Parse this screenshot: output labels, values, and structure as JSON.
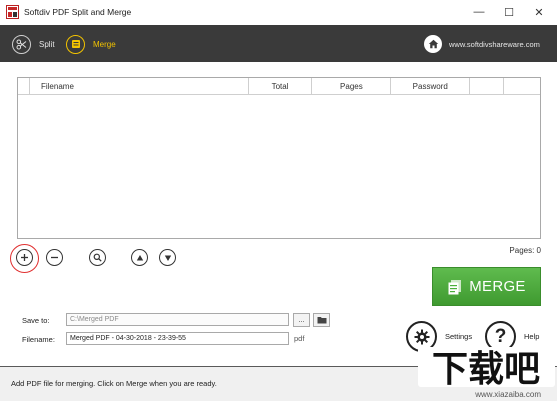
{
  "window": {
    "title": "Softdiv PDF Split and Merge",
    "controls": {
      "minimize": "—",
      "maximize": "☐",
      "close": "✕"
    }
  },
  "topbar": {
    "modes": [
      {
        "label": "Split",
        "icon": "scissors-icon",
        "active": false
      },
      {
        "label": "Merge",
        "icon": "merge-doc-icon",
        "active": true
      }
    ],
    "site_label": "www.softdivshareware.com",
    "site_icon": "home-icon",
    "colors": {
      "background": "#3a3a3a",
      "active": "#f2c300"
    }
  },
  "file_table": {
    "columns": [
      "",
      "Filename",
      "Total",
      "Pages",
      "Password",
      "",
      ""
    ],
    "rows": []
  },
  "list_controls": {
    "add_icon": "plus-icon",
    "remove_icon": "minus-icon",
    "preview_icon": "search-icon",
    "move_up_icon": "arrow-up-icon",
    "move_down_icon": "arrow-down-icon",
    "pages_count": "Pages: 0"
  },
  "merge_button": {
    "label": "MERGE",
    "color": "#4caf3c"
  },
  "output": {
    "save_to_label": "Save to:",
    "save_to_value": "C:\\Merged PDF",
    "browse_label": "...",
    "filename_label": "Filename:",
    "filename_value": "Merged PDF - 04-30-2018 - 23-39-55",
    "extension": "pdf"
  },
  "settings": {
    "label": "Settings",
    "icon": "gear-icon"
  },
  "help": {
    "label": "Help",
    "icon": "question-icon"
  },
  "status_text": "Add PDF file for merging. Click on Merge when you are ready.",
  "watermark": {
    "text": "下载吧",
    "url": "www.xiazaiba.com"
  }
}
